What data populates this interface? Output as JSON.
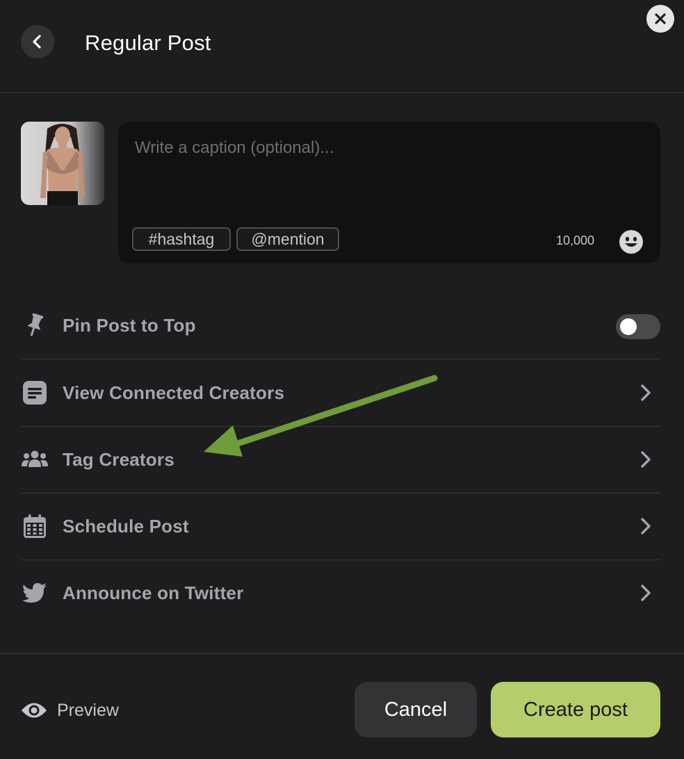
{
  "header": {
    "title": "Regular Post",
    "back_icon": "chevron-left-icon",
    "close_icon": "close-icon"
  },
  "composer": {
    "caption_placeholder": "Write a caption (optional)...",
    "caption_value": "",
    "chips": [
      "#hashtag",
      "@mention"
    ],
    "char_count": "10,000",
    "emoji_icon": "smiley-icon",
    "thumbnail": "post-image-thumbnail"
  },
  "options": [
    {
      "label": "Pin Post to Top",
      "icon": "pin-icon",
      "control": "toggle",
      "toggle_on": false
    },
    {
      "label": "View Connected Creators",
      "icon": "article-icon",
      "control": "chevron"
    },
    {
      "label": "Tag Creators",
      "icon": "users-icon",
      "control": "chevron"
    },
    {
      "label": "Schedule Post",
      "icon": "calendar-icon",
      "control": "chevron"
    },
    {
      "label": "Announce on Twitter",
      "icon": "twitter-icon",
      "control": "chevron"
    }
  ],
  "annotation": {
    "type": "arrow",
    "color": "#6f9c3d",
    "points_to": "Tag Creators"
  },
  "footer": {
    "preview_label": "Preview",
    "preview_icon": "eye-icon",
    "cancel_label": "Cancel",
    "create_label": "Create post"
  },
  "colors": {
    "background": "#1d1d1f",
    "accent": "#b5cd6a",
    "secondary_button": "#333336",
    "muted_text": "#a6a6aa"
  }
}
